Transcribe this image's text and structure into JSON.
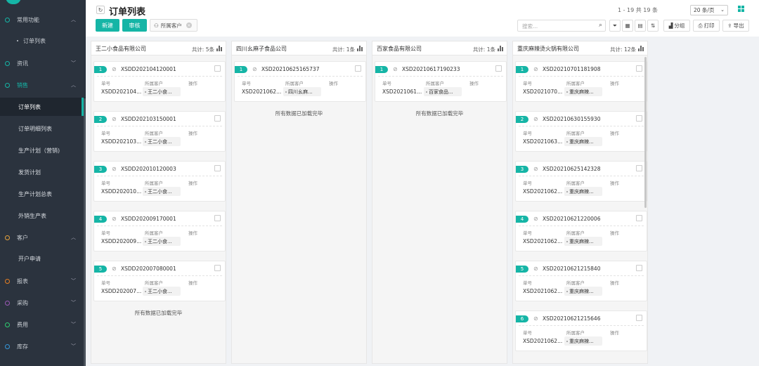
{
  "sidebar": {
    "items": [
      {
        "label": "常用功能",
        "chevron": "up"
      },
      {
        "label": "订单列表"
      },
      {
        "label": "资讯",
        "chevron": "down"
      },
      {
        "label": "销售",
        "chevron": "up"
      },
      {
        "label": "订单列表"
      },
      {
        "label": "订单明细列表"
      },
      {
        "label": "生产计划（营销)"
      },
      {
        "label": "发货计划"
      },
      {
        "label": "生产计划总表"
      },
      {
        "label": "外销生产表"
      },
      {
        "label": "客户",
        "chevron": "up"
      },
      {
        "label": "开户申请"
      },
      {
        "label": "报表",
        "chevron": "down"
      },
      {
        "label": "采购",
        "chevron": "down"
      },
      {
        "label": "费用",
        "chevron": "down"
      },
      {
        "label": "库存",
        "chevron": "down"
      }
    ],
    "colors": {
      "bg": "#2b333e",
      "accent": "#15b5a6"
    }
  },
  "header": {
    "title": "订单列表",
    "pager": "1 - 19 共 19 条",
    "page_size": "20 条/页",
    "buttons": {
      "new": "新建",
      "review": "审核"
    },
    "filter_tag": "所属客户",
    "search_placeholder": "搜索...",
    "tools": {
      "group": "分组",
      "print": "打印",
      "export": "导出"
    }
  },
  "columns": [
    {
      "name": "王二小食品有限公司",
      "count": "共计: 5条",
      "cards": [
        {
          "num": "1",
          "code": "XSDD202104120001",
          "order": "XSDD202104...",
          "customer": "王二小食..."
        },
        {
          "num": "2",
          "code": "XSDD202103150001",
          "order": "XSDD202103...",
          "customer": "王二小食..."
        },
        {
          "num": "3",
          "code": "XSDD202010120003",
          "order": "XSDD202010...",
          "customer": "王二小食..."
        },
        {
          "num": "4",
          "code": "XSDD202009170001",
          "order": "XSDD202009...",
          "customer": "王二小食..."
        },
        {
          "num": "5",
          "code": "XSDD202007080001",
          "order": "XSDD202007...",
          "customer": "王二小食..."
        }
      ],
      "footer": "所有数据已加载完毕"
    },
    {
      "name": "四川幺麻子食品公司",
      "count": "共计: 1条",
      "cards": [
        {
          "num": "1",
          "code": "XSD20210625165737",
          "order": "XSD2021062...",
          "customer": "四川幺麻..."
        }
      ],
      "footer": "所有数据已加载完毕"
    },
    {
      "name": "百家食品有限公司",
      "count": "共计: 1条",
      "cards": [
        {
          "num": "1",
          "code": "XSD20210617190233",
          "order": "XSD2021061...",
          "customer": "百家食品..."
        }
      ],
      "footer": "所有数据已加载完毕"
    },
    {
      "name": "重庆麻辣烫火锅有限公司",
      "count": "共计: 12条",
      "cards": [
        {
          "num": "1",
          "code": "XSD20210701181908",
          "order": "XSD2021070...",
          "customer": "重庆麻辣..."
        },
        {
          "num": "2",
          "code": "XSD20210630155930",
          "order": "XSD2021063...",
          "customer": "重庆麻辣..."
        },
        {
          "num": "3",
          "code": "XSD20210625142328",
          "order": "XSD2021062...",
          "customer": "重庆麻辣..."
        },
        {
          "num": "4",
          "code": "XSD20210621220006",
          "order": "XSD2021062...",
          "customer": "重庆麻辣..."
        },
        {
          "num": "5",
          "code": "XSD20210621215840",
          "order": "XSD2021062...",
          "customer": "重庆麻辣..."
        },
        {
          "num": "6",
          "code": "XSD20210621215646",
          "order": "XSD2021062...",
          "customer": "重庆麻辣..."
        }
      ]
    }
  ],
  "card_headers": {
    "order": "单号",
    "customer": "所属客户",
    "action": "操作"
  }
}
